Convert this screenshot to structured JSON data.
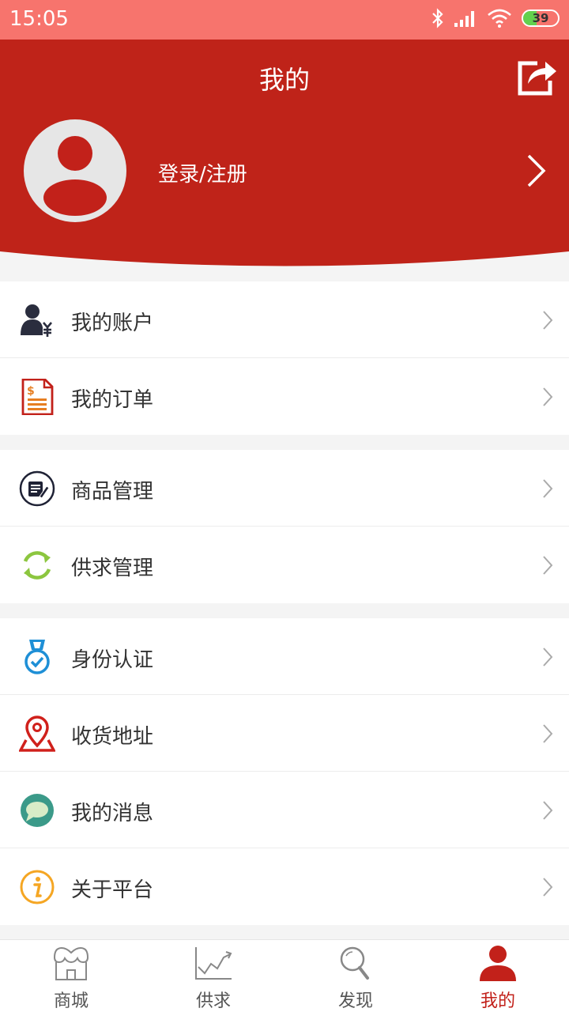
{
  "status_bar": {
    "time": "15:05",
    "battery": "39",
    "battery_level_percent": 39,
    "icons": [
      "bluetooth-icon",
      "signal-icon",
      "wifi-icon",
      "battery-icon"
    ]
  },
  "header": {
    "title": "我的",
    "login_label": "登录/注册",
    "icons": [
      "share-icon",
      "avatar-icon",
      "chevron-right-icon"
    ]
  },
  "menu": {
    "group1": [
      {
        "label": "我的账户",
        "icon": "account-yuan-icon"
      },
      {
        "label": "我的订单",
        "icon": "order-invoice-icon"
      }
    ],
    "group2": [
      {
        "label": "商品管理",
        "icon": "goods-edit-icon"
      },
      {
        "label": "供求管理",
        "icon": "supply-cycle-icon"
      }
    ],
    "group3": [
      {
        "label": "身份认证",
        "icon": "medal-check-icon"
      },
      {
        "label": "收货地址",
        "icon": "location-pin-icon"
      },
      {
        "label": "我的消息",
        "icon": "message-bubble-icon"
      },
      {
        "label": "关于平台",
        "icon": "info-icon"
      }
    ]
  },
  "tabbar": {
    "tabs": [
      {
        "label": "商城",
        "icon": "store-icon",
        "active": false
      },
      {
        "label": "供求",
        "icon": "trend-chart-icon",
        "active": false
      },
      {
        "label": "发现",
        "icon": "magnifier-icon",
        "active": false
      },
      {
        "label": "我的",
        "icon": "user-icon",
        "active": true
      }
    ]
  },
  "colors": {
    "header_red": "#bf2319",
    "status_bar": "#f7746d",
    "active_tab": "#c2211a",
    "battery_green": "#63d14e"
  }
}
